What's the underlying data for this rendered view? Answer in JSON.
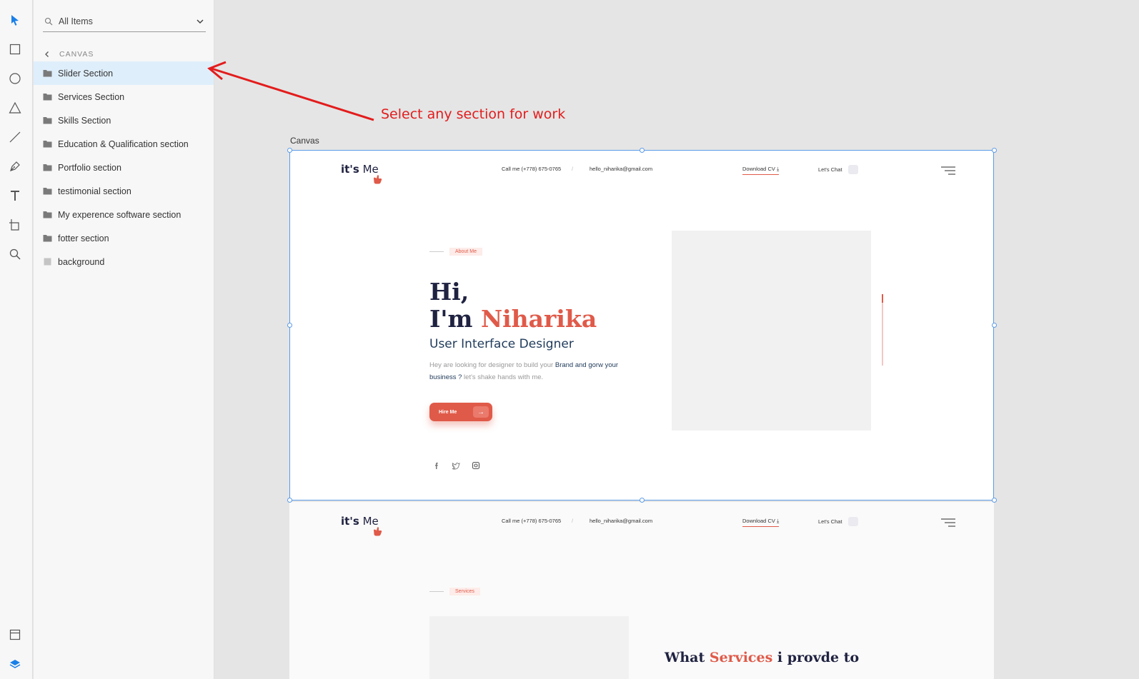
{
  "search": {
    "placeholder_value": "All Items"
  },
  "layers": {
    "breadcrumb": "CANVAS",
    "items": [
      {
        "label": "Slider Section",
        "selected": true
      },
      {
        "label": "Services Section"
      },
      {
        "label": "Skills Section"
      },
      {
        "label": "Education & Qualification section"
      },
      {
        "label": "Portfolio section"
      },
      {
        "label": "testimonial section"
      },
      {
        "label": "My experence software section"
      },
      {
        "label": "fotter section"
      },
      {
        "label": "background"
      }
    ]
  },
  "annotation": {
    "text": "Select any section for work",
    "color": "#e31c1c"
  },
  "canvas": {
    "label": "Canvas"
  },
  "site": {
    "logo_bold": "it's",
    "logo_light": " Me",
    "phone": "Call me (+778) 675-0765",
    "separator": "/",
    "email": "hello_niharika@gmail.com",
    "download_cv": "Download CV",
    "lets_chat": "Let's Chat",
    "about_tag": "About Me",
    "hero_line1": "Hi,",
    "hero_im": "I'm ",
    "hero_name": "Niharika",
    "hero_role": "User Interface Designer",
    "desc_part1": "Hey are looking for designer to build your ",
    "desc_highlight": "Brand and gorw your business ?",
    "desc_part2": "  let's shake hands with me.",
    "hire_label": "Hire Me",
    "services_tag": "Services",
    "services_title_a": "What ",
    "services_title_accent": "Services",
    "services_title_b": " i provde to"
  },
  "colors": {
    "accent": "#e05a49",
    "navy": "#1f2240",
    "selection": "#5b9be8",
    "tool_active": "#1a7fe8"
  }
}
